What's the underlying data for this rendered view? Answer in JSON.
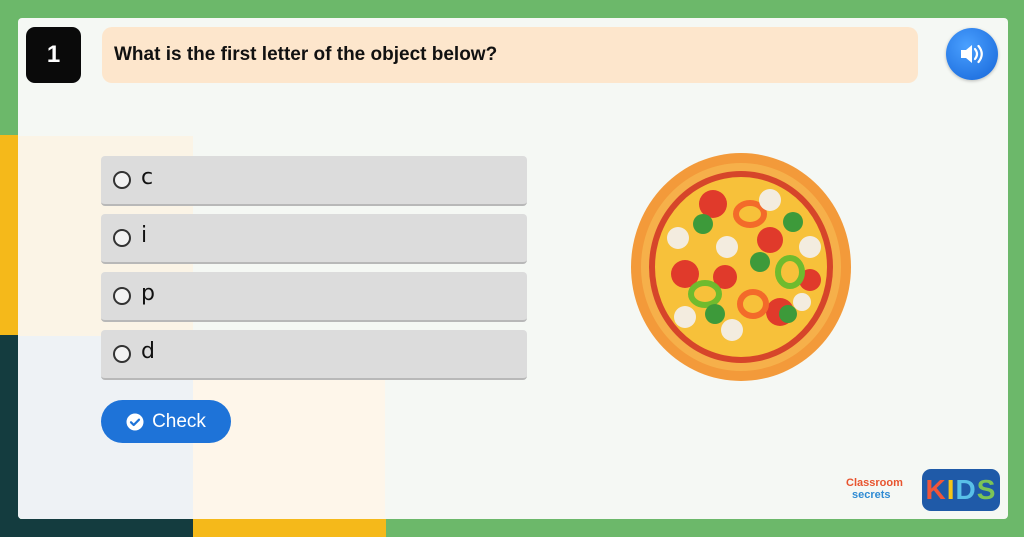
{
  "question": {
    "number": "1",
    "text": "What is the first letter of the object below?"
  },
  "audio": {
    "icon": "speaker-icon"
  },
  "options": [
    {
      "label": "c"
    },
    {
      "label": "i"
    },
    {
      "label": "p"
    },
    {
      "label": "d"
    }
  ],
  "check_button": {
    "label": "Check",
    "icon": "check-circle-icon"
  },
  "image": {
    "icon": "pizza-icon"
  },
  "brand": {
    "classroom": "Classroom",
    "secrets": "secrets",
    "kids_letters": [
      "K",
      "I",
      "D",
      "S"
    ]
  },
  "colors": {
    "background": "#6cb86a",
    "question_bar": "#fde6cc",
    "option_bg": "#dcdcdc",
    "accent_blue": "#1e73d8",
    "qnum_bg": "#0a0a0a"
  }
}
